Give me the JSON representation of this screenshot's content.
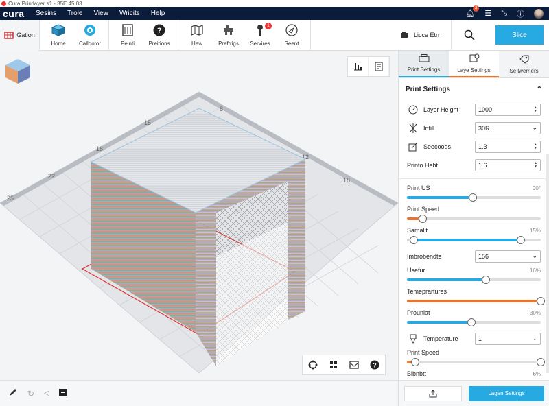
{
  "window": {
    "title": "Cura  Printlayer s1 - 35E 45.03"
  },
  "menu": {
    "brand": "cura",
    "items": [
      "Sesins",
      "Trole",
      "View",
      "Wricits",
      "Help"
    ],
    "notification_count": "2"
  },
  "toolbar": {
    "first_label": "Gation",
    "groups": [
      [
        {
          "label": "Home",
          "icon": "cube-icon"
        },
        {
          "label": "Calldotor",
          "icon": "target-icon"
        }
      ],
      [
        {
          "label": "Peinti",
          "icon": "printer-icon"
        },
        {
          "label": "Preitions",
          "icon": "help-icon"
        }
      ],
      [
        {
          "label": "Hew",
          "icon": "map-icon"
        },
        {
          "label": "Preftrigs",
          "icon": "hand-icon"
        },
        {
          "label": "Servires",
          "icon": "wrench-icon",
          "badge": "1"
        },
        {
          "label": "Seent",
          "icon": "send-icon"
        }
      ]
    ],
    "device_label": "Licce Etrr",
    "slice_label": "Slice"
  },
  "panel": {
    "tabs": [
      {
        "label": "Print Settings"
      },
      {
        "label": "Laye Settings"
      },
      {
        "label": "Se lwerrlers"
      }
    ],
    "section_title": "Print Settings",
    "rows": [
      {
        "label": "Layer Height",
        "value": "1000",
        "kind": "spin",
        "icon": "gauge-icon"
      },
      {
        "label": "Infill",
        "value": "30R",
        "kind": "select",
        "icon": "infill-icon"
      },
      {
        "label": "Seecoogs",
        "value": "1.3",
        "kind": "spin",
        "icon": "edit-icon"
      },
      {
        "label": "Printo Heht",
        "value": "1.6",
        "kind": "spin",
        "icon": ""
      }
    ],
    "sliders": [
      {
        "label": "Print US",
        "value": "00°",
        "fill": 0.49,
        "color": "#27a9e1"
      },
      {
        "label": "Print Speed",
        "value": "",
        "fill": 0.12,
        "color": "#e8742f"
      },
      {
        "label": "Samalit",
        "value": "15%",
        "fill": 0.85,
        "low": 0.05,
        "color": "#27a9e1",
        "range": true
      }
    ],
    "select_row": {
      "label": "Imbrobendte",
      "value": "156"
    },
    "sliders2": [
      {
        "label": "Usefur",
        "value": "16%",
        "fill": 0.59,
        "color": "#27a9e1"
      },
      {
        "label": "Temeprartures",
        "value": "",
        "fill": 1.0,
        "color": "#e8742f"
      },
      {
        "label": "Prouniat",
        "value": "30%",
        "fill": 0.48,
        "color": "#27a9e1"
      }
    ],
    "temp_row": {
      "label": "Temperature",
      "value": "1"
    },
    "sliders3": [
      {
        "label": "Print Speed",
        "value": "",
        "fill": 0.06,
        "color": "#e8742f",
        "end_knob": true
      }
    ],
    "last_row": {
      "label": "Bibnbtt",
      "value": "6%"
    },
    "footer_button": "Lagen Settings"
  },
  "viewport": {
    "axis_labels": [
      "1",
      "8",
      "12",
      "15",
      "18",
      "22",
      "25"
    ],
    "colors": {
      "accent": "#27a9e1",
      "orange": "#e8742f",
      "menubar": "#0b1b3a"
    }
  }
}
